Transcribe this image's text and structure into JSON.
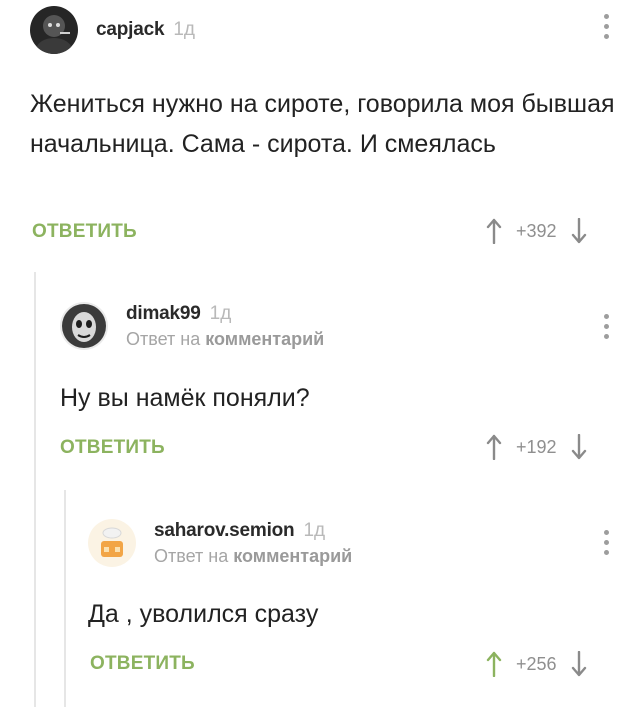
{
  "comments": [
    {
      "username": "capjack",
      "time": "1д",
      "text": "Жениться нужно на сироте, говорила моя бывшая начальница. Сама - сирота. И смеялась",
      "reply_label": "ОТВЕТИТЬ",
      "score": "+392",
      "upvoted": false
    },
    {
      "username": "dimak99",
      "time": "1д",
      "reply_prefix": "Ответ на",
      "reply_target": "комментарий",
      "text": "Ну вы намёк поняли?",
      "reply_label": "ОТВЕТИТЬ",
      "score": "+192",
      "upvoted": false
    },
    {
      "username": "saharov.semion",
      "time": "1д",
      "reply_prefix": "Ответ на",
      "reply_target": "комментарий",
      "text": "Да , уволился сразу",
      "reply_label": "ОТВЕТИТЬ",
      "score": "+256",
      "upvoted": true
    }
  ],
  "colors": {
    "accent_green": "#8cb35f",
    "muted_text": "#a5a5a5",
    "thread_line": "#e6e6e6"
  },
  "icons": [
    "avatar-capjack",
    "avatar-dimak99",
    "avatar-saharov",
    "kebab-menu-icon",
    "arrow-up-icon",
    "arrow-down-icon"
  ]
}
